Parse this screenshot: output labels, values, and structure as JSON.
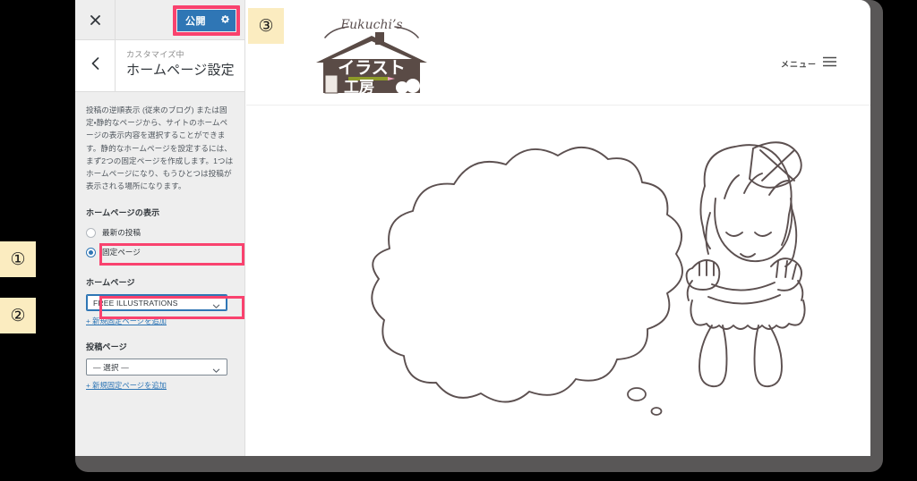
{
  "customizer": {
    "close_icon": "close-x-icon",
    "publish_label": "公開",
    "gear_icon": "gear-icon",
    "back_icon": "chevron-left-icon",
    "eyebrow": "カスタマイズ中",
    "title": "ホームページ設定",
    "description": "投稿の逆順表示 (従来のブログ) または固定・静的なページから、サイトのホームページの表示内容を選択することができます。静的なホームページを設定するには、まず2つの固定ページを作成します。1つはホームページになり、もうひとつは投稿が表示される場所になります。",
    "display_section": {
      "label": "ホームページの表示",
      "options": [
        {
          "label": "最新の投稿",
          "selected": false
        },
        {
          "label": "固定ページ",
          "selected": true
        }
      ]
    },
    "homepage_section": {
      "label": "ホームページ",
      "selected_value": "FREE ILLUSTRATIONS",
      "add_link": "+ 新規固定ページを追加",
      "arrow_icon": "chevron-down-icon"
    },
    "posts_page_section": {
      "label": "投稿ページ",
      "selected_value": "— 選択 —",
      "add_link": "+ 新規固定ページを追加",
      "arrow_icon": "chevron-down-icon"
    }
  },
  "preview": {
    "logo": {
      "script_text": "Fukuchi's",
      "main_text_top": "イラスト",
      "main_text_bottom": "工房",
      "icon": "house-logo-icon"
    },
    "nav": {
      "menu_label": "メニュー",
      "hamburger_icon": "hamburger-menu-icon"
    },
    "illustration": {
      "name": "girl-with-thought-bubble-illustration",
      "bubble": "thought-bubble-icon",
      "character": "girl-resting-chin-icon"
    }
  },
  "annotations": [
    {
      "id": "1",
      "symbol": "①"
    },
    {
      "id": "2",
      "symbol": "②"
    },
    {
      "id": "3",
      "symbol": "③"
    }
  ],
  "colors": {
    "highlight": "#f9426e",
    "publish_blue": "#2f76b5",
    "annotation_bg": "#fbecc0",
    "sidebar_bg": "#eeeeee",
    "frame": "#595757",
    "link": "#2f76b5",
    "ink": "#5c5050"
  }
}
